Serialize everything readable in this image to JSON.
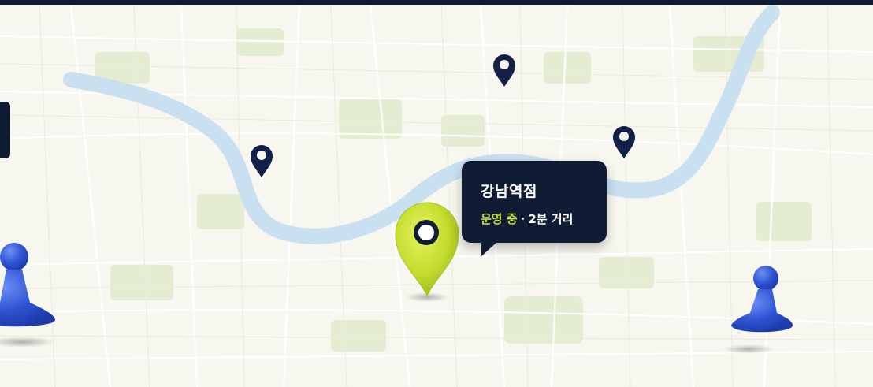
{
  "callout": {
    "store_name": "강남역점",
    "status": "운영 중",
    "separator": "·",
    "distance": "2분 거리"
  },
  "colors": {
    "background": "#f7f6ef",
    "river": "#cfe4f3",
    "park": "#e3ecd0",
    "pin_primary": "#c4dc2e",
    "pin_secondary": "#13204a",
    "pawn": "#2f55d4",
    "callout_bg": "#101b34"
  },
  "icons": [
    "map-pin-primary-icon",
    "map-pin-icon",
    "pawn-figure-icon"
  ]
}
